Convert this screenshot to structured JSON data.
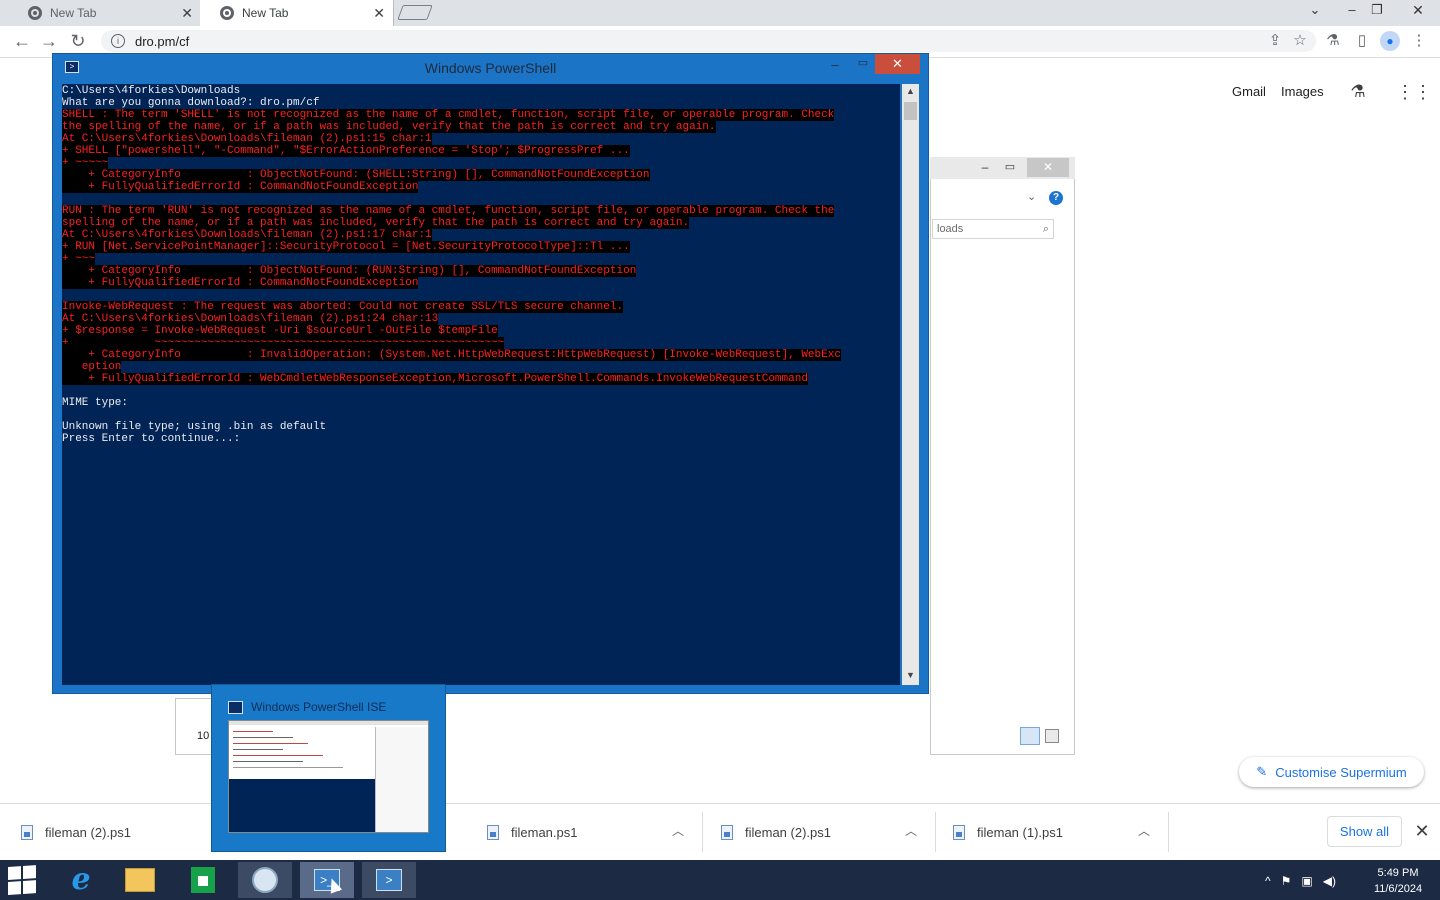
{
  "browser": {
    "tabs": [
      {
        "label": "New Tab"
      },
      {
        "label": "New Tab"
      }
    ],
    "address": "dro.pm/cf",
    "ntp_links": {
      "gmail": "Gmail",
      "images": "Images"
    }
  },
  "powershell": {
    "title": "Windows PowerShell",
    "lines": [
      {
        "text": "C:\\Users\\4forkies\\Downloads",
        "err": false
      },
      {
        "text": "What are you gonna download?: dro.pm/cf",
        "err": false
      },
      {
        "text": "SHELL : The term 'SHELL' is not recognized as the name of a cmdlet, function, script file, or operable program. Check",
        "err": true
      },
      {
        "text": "the spelling of the name, or if a path was included, verify that the path is correct and try again.",
        "err": true
      },
      {
        "text": "At C:\\Users\\4forkies\\Downloads\\fileman (2).ps1:15 char:1",
        "err": true
      },
      {
        "text": "+ SHELL [\"powershell\", \"-Command\", \"$ErrorActionPreference = 'Stop'; $ProgressPref ...",
        "err": true
      },
      {
        "text": "+ ~~~~~",
        "err": true
      },
      {
        "text": "    + CategoryInfo          : ObjectNotFound: (SHELL:String) [], CommandNotFoundException",
        "err": true
      },
      {
        "text": "    + FullyQualifiedErrorId : CommandNotFoundException",
        "err": true
      },
      {
        "text": "",
        "err": false
      },
      {
        "text": "RUN : The term 'RUN' is not recognized as the name of a cmdlet, function, script file, or operable program. Check the",
        "err": true
      },
      {
        "text": "spelling of the name, or if a path was included, verify that the path is correct and try again.",
        "err": true
      },
      {
        "text": "At C:\\Users\\4forkies\\Downloads\\fileman (2).ps1:17 char:1",
        "err": true
      },
      {
        "text": "+ RUN [Net.ServicePointManager]::SecurityProtocol = [Net.SecurityProtocolType]::Tl ...",
        "err": true
      },
      {
        "text": "+ ~~~",
        "err": true
      },
      {
        "text": "    + CategoryInfo          : ObjectNotFound: (RUN:String) [], CommandNotFoundException",
        "err": true
      },
      {
        "text": "    + FullyQualifiedErrorId : CommandNotFoundException",
        "err": true
      },
      {
        "text": "",
        "err": false
      },
      {
        "text": "Invoke-WebRequest : The request was aborted: Could not create SSL/TLS secure channel.",
        "err": true
      },
      {
        "text": "At C:\\Users\\4forkies\\Downloads\\fileman (2).ps1:24 char:13",
        "err": true
      },
      {
        "text": "+ $response = Invoke-WebRequest -Uri $sourceUrl -OutFile $tempFile",
        "err": true
      },
      {
        "text": "+             ~~~~~~~~~~~~~~~~~~~~~~~~~~~~~~~~~~~~~~~~~~~~~~~~~~~~~",
        "err": true
      },
      {
        "text": "    + CategoryInfo          : InvalidOperation: (System.Net.HttpWebRequest:HttpWebRequest) [Invoke-WebRequest], WebExc",
        "err": true
      },
      {
        "text": "   eption",
        "err": true
      },
      {
        "text": "    + FullyQualifiedErrorId : WebCmdletWebResponseException,Microsoft.PowerShell.Commands.InvokeWebRequestCommand",
        "err": true
      },
      {
        "text": "",
        "err": false
      },
      {
        "text": "MIME type:",
        "err": false
      },
      {
        "text": "",
        "err": false
      },
      {
        "text": "Unknown file type; using .bin as default",
        "err": false
      },
      {
        "text": "Press Enter to continue...:",
        "err": false
      }
    ]
  },
  "explorer": {
    "search_placeholder": "loads",
    "item_count": "10"
  },
  "preview": {
    "title": "Windows PowerShell ISE"
  },
  "downloads": {
    "items": [
      {
        "name": "fileman (2).ps1"
      },
      {
        "name": "fileman.ps1"
      },
      {
        "name": "fileman (2).ps1"
      },
      {
        "name": "fileman (1).ps1"
      }
    ],
    "show_all": "Show all",
    "customise": "Customise Supermium"
  },
  "taskbar": {
    "time": "5:49 PM",
    "date": "11/6/2024"
  },
  "colors": {
    "powershell_bg": "#012456",
    "error_text": "#ff1f1f",
    "window_frame": "#1c74c7",
    "taskbar": "#1d2a44",
    "accent_link": "#1a73e8"
  }
}
